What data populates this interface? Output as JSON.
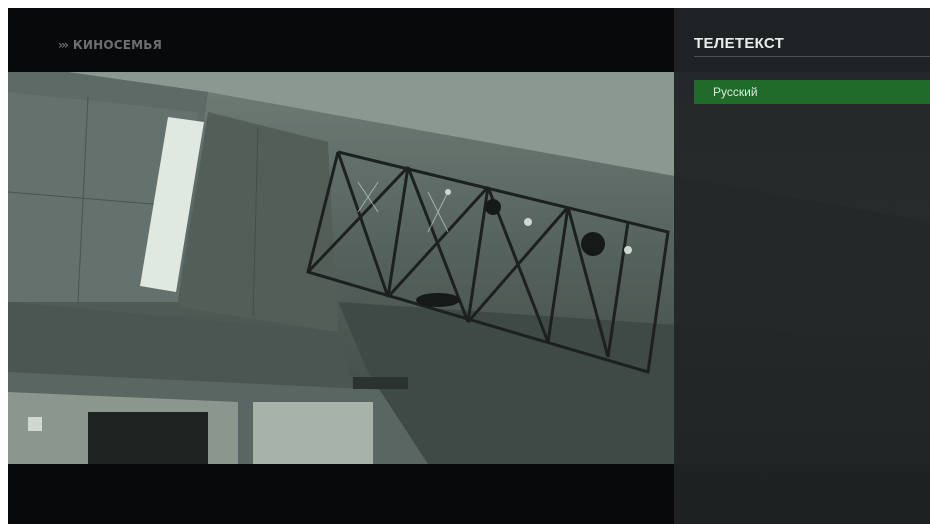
{
  "channel": {
    "logo_text": "КИНОСЕМЬЯ",
    "logo_arrows": "›››"
  },
  "teletext_panel": {
    "title": "ТЕЛЕТЕКСТ",
    "items": [
      {
        "label": "Русский",
        "selected": true
      }
    ]
  },
  "colors": {
    "selected_item": "#1f6b2a",
    "panel_background": "#202426",
    "screen_background": "#07090b"
  }
}
